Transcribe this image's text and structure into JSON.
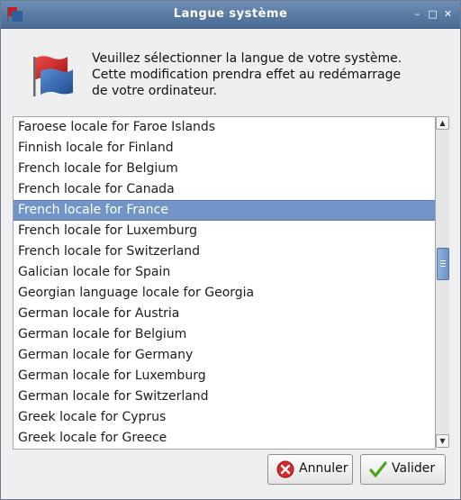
{
  "window": {
    "title": "Langue système"
  },
  "message": {
    "line1": "Veuillez sélectionner la langue de votre système.",
    "line2": "Cette modification prendra effet au redémarrage",
    "line3": "de votre ordinateur."
  },
  "locales": [
    "Faroese locale for Faroe Islands",
    "Finnish locale for Finland",
    "French locale for Belgium",
    "French locale for Canada",
    "French locale for France",
    "French locale for Luxemburg",
    "French locale for Switzerland",
    "Galician locale for Spain",
    "Georgian language locale for Georgia",
    "German locale for Austria",
    "German locale for Belgium",
    "German locale for Germany",
    "German locale for Luxemburg",
    "German locale for Switzerland",
    "Greek locale for Cyprus",
    "Greek locale for Greece"
  ],
  "selected_locale": "French locale for France",
  "buttons": {
    "cancel": "Annuler",
    "ok": "Valider"
  },
  "colors": {
    "titlebar": "#587aa2",
    "selection": "#7195c6",
    "cancel_icon": "#d42a2a",
    "ok_icon": "#4fa123"
  }
}
